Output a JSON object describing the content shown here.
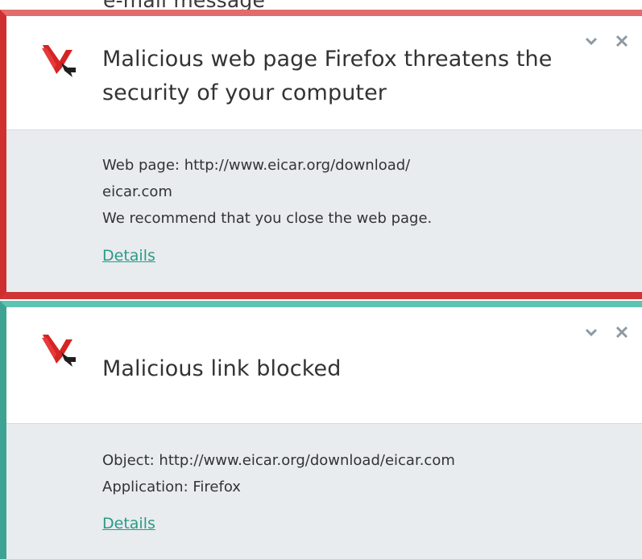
{
  "top_cut_text": "e-mail message",
  "notifications": [
    {
      "title": "Malicious web page Firefox threatens the security of your computer",
      "body_lines": [
        "Web page: http://www.eicar.org/download/",
        "eicar.com",
        "We recommend that you close the web page."
      ],
      "details_label": "Details",
      "accent_color": "#cf2f2f"
    },
    {
      "title": "Malicious link blocked",
      "body_lines": [
        "Object: http://www.eicar.org/download/eicar.com",
        "Application: Firefox"
      ],
      "details_label": "Details",
      "accent_color": "#3ea392"
    }
  ],
  "icons": {
    "logo": "kaspersky-k-logo",
    "collapse": "chevron-down-icon",
    "close": "close-icon"
  },
  "link_color": "#2a9a87"
}
